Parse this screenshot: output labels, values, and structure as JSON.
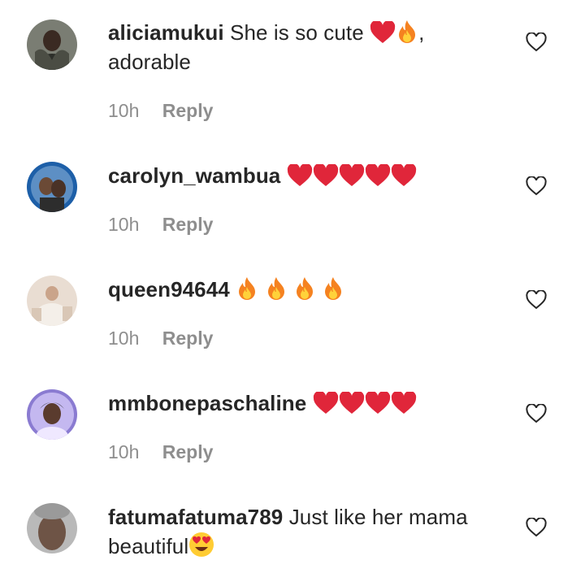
{
  "comments": [
    {
      "username": "aliciamukui",
      "text_before": "She is so cute ",
      "emojis": [
        "heart",
        "fire"
      ],
      "text_after": ",",
      "line2": "adorable",
      "time": "10h",
      "reply_label": "Reply"
    },
    {
      "username": "carolyn_wambua",
      "text_before": "",
      "emojis": [
        "heart",
        "heart",
        "heart",
        "heart",
        "heart"
      ],
      "text_after": "",
      "line2": "",
      "time": "10h",
      "reply_label": "Reply"
    },
    {
      "username": "queen94644",
      "text_before": "",
      "emojis": [
        "fire",
        "fire",
        "fire",
        "fire"
      ],
      "text_after": "",
      "line2": "",
      "time": "10h",
      "reply_label": "Reply"
    },
    {
      "username": "mmbonepaschaline",
      "text_before": "",
      "emojis": [
        "heart",
        "heart",
        "heart",
        "heart"
      ],
      "text_after": "",
      "line2": "",
      "time": "10h",
      "reply_label": "Reply"
    },
    {
      "username": "fatumafatuma789",
      "text_before": "Just like her mama",
      "emojis": [],
      "text_after": "",
      "line2": "beautiful",
      "line2_emoji": "heart-eyes",
      "time": "",
      "reply_label": ""
    }
  ],
  "colors": {
    "text": "#262626",
    "meta": "#8e8e8e",
    "heart": "#e0263a"
  }
}
